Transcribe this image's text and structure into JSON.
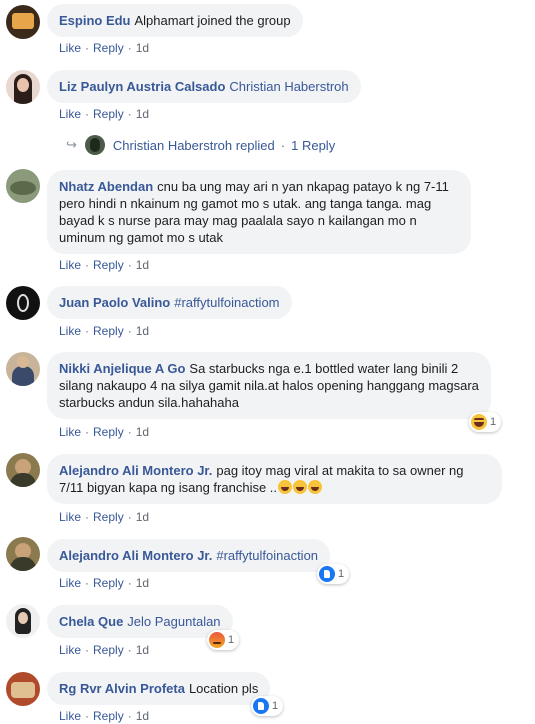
{
  "comments": [
    {
      "author": "Espino Edu",
      "text": "Alphamart joined the group",
      "like": "Like",
      "reply": "Reply",
      "time": "1d",
      "avatar_color": "#3b2a1a"
    },
    {
      "author": "Liz Paulyn Austria Calsado",
      "text": "Christian Haberstroh",
      "like": "Like",
      "reply": "Reply",
      "time": "1d",
      "avatar_color": "#c9a59a"
    },
    {
      "author": "Nhatz Abendan",
      "text": "cnu ba ung may ari n yan nkapag patayo k ng 7-11 pero hindi n nkainum ng gamot mo s utak. ang tanga tanga. mag bayad k s nurse para may mag paalala sayo n kailangan mo n uminum ng gamot mo s utak",
      "like": "Like",
      "reply": "Reply",
      "time": "1d",
      "avatar_color": "#8a9a7a"
    },
    {
      "author": "Juan Paolo Valino",
      "text": "#raffytulfoinactiom",
      "like": "Like",
      "reply": "Reply",
      "time": "1d",
      "avatar_color": "#111111"
    },
    {
      "author": "Nikki Anjelique A Go",
      "text": "Sa starbucks nga e.1 bottled water lang binili 2 silang nakaupo 4 na silya gamit nila.at halos opening hanggang magsara starbucks andun sila.hahahaha",
      "like": "Like",
      "reply": "Reply",
      "time": "1d",
      "avatar_color": "#a28a6e",
      "reaction_count": "1"
    },
    {
      "author": "Alejandro Ali Montero Jr.",
      "text": "pag itoy mag viral at makita to sa owner ng 7/11 bigyan kapa ng isang franchise ..",
      "like": "Like",
      "reply": "Reply",
      "time": "1d",
      "avatar_color": "#7a6a3e"
    },
    {
      "author": "Alejandro Ali Montero Jr.",
      "text": "#raffytulfoinaction",
      "like": "Like",
      "reply": "Reply",
      "time": "1d",
      "avatar_color": "#7a6a3e",
      "reaction_count": "1"
    },
    {
      "author": "Chela Que",
      "text": "Jelo Paguntalan",
      "like": "Like",
      "reply": "Reply",
      "time": "1d",
      "avatar_color": "#2a2a2a",
      "reaction_count": "1"
    },
    {
      "author": "Rg Rvr Alvin Profeta",
      "text": "Location pls",
      "like": "Like",
      "reply": "Reply",
      "time": "1d",
      "avatar_color": "#b04a2a",
      "reaction_count": "1"
    }
  ],
  "reply_summary": {
    "name": "Christian Haberstroh replied",
    "count": "1 Reply"
  }
}
